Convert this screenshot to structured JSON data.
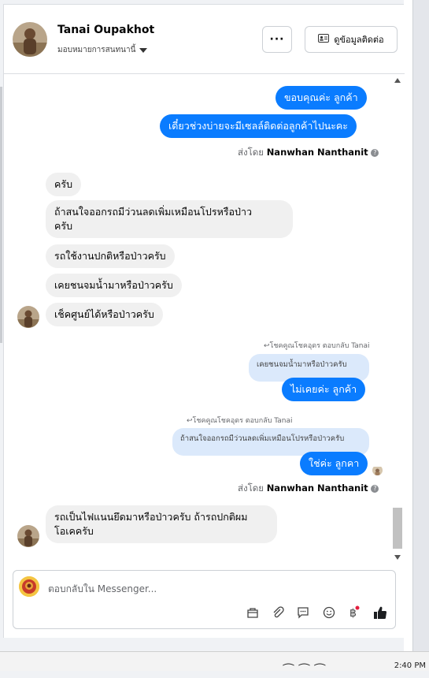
{
  "header": {
    "contact_name": "Tanai Oupakhot",
    "assign_label": "มอบหมายการสนทนานี้",
    "more_label": "···",
    "contact_info_label": "ดูข้อมูลติดต่อ"
  },
  "messages": {
    "out1": "ขอบคุณค่ะ ลูกค้า",
    "out2": "เดี๋ยวช่วงบ่ายจะมีเซลล์ติดต่อลูกค้าไปนะคะ",
    "sent_by_prefix": "ส่งโดย",
    "sent_by_name": "Nanwhan Nanthanit",
    "in1": "ครับ",
    "in2a": "ถ้าสนใจออกรถมีว่วนลดเพิ่มเหมือนโปรหรือป่าว",
    "in2b": "ครับ",
    "in3": "รถใช้งานปกติหรือป่าวครับ",
    "in4": "เคยชนจมน้ำมาหรือป่าวครับ",
    "in5": "เช็คศูนย์ได้หรือป่าวครับ",
    "reply1_label": "โชคคูณโชคอุดร ตอบกลับ Tanai",
    "reply1_quote": "เคยชนจมน้ำมาหรือป่าวครับ",
    "reply1_text": "ไม่เคยค่ะ ลูกค้า",
    "reply2_label": "โชคคูณโชคอุดร ตอบกลับ Tanai",
    "reply2_quote": "ถ้าสนใจออกรถมีว่วนลดเพิ่มเหมือนโปรหรือป่าวครับ",
    "reply2_text": "ใช่ค่ะ ลูกคา",
    "sent_by2_prefix": "ส่งโดย",
    "sent_by2_name": "Nanwhan Nanthanit",
    "in6a": "รถเป็นไฟแนนยึดมาหรือป่าวครับ ถ้ารถปกติผม",
    "in6b": "โอเคครับ"
  },
  "composer": {
    "placeholder": "ตอบกลับใน Messenger..."
  },
  "taskbar": {
    "clock": "2:40 PM"
  },
  "colors": {
    "accent": "#0a7cff",
    "incoming_bubble": "#f0f0f0",
    "quote_bubble": "#dbe9fb"
  }
}
